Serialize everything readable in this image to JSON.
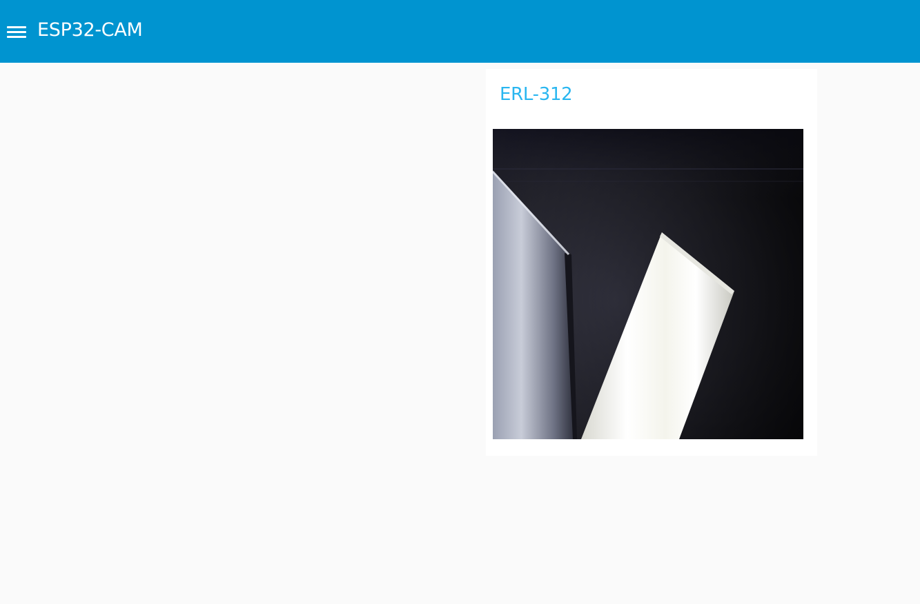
{
  "header": {
    "menu_icon": "hamburger-menu-icon",
    "title": "ESP32-CAM",
    "background_color": "#0094d0"
  },
  "camera_card": {
    "title": "ERL-312",
    "title_color": "#29b6f0",
    "stream_image": "live camera frame showing a ceiling light panel"
  }
}
